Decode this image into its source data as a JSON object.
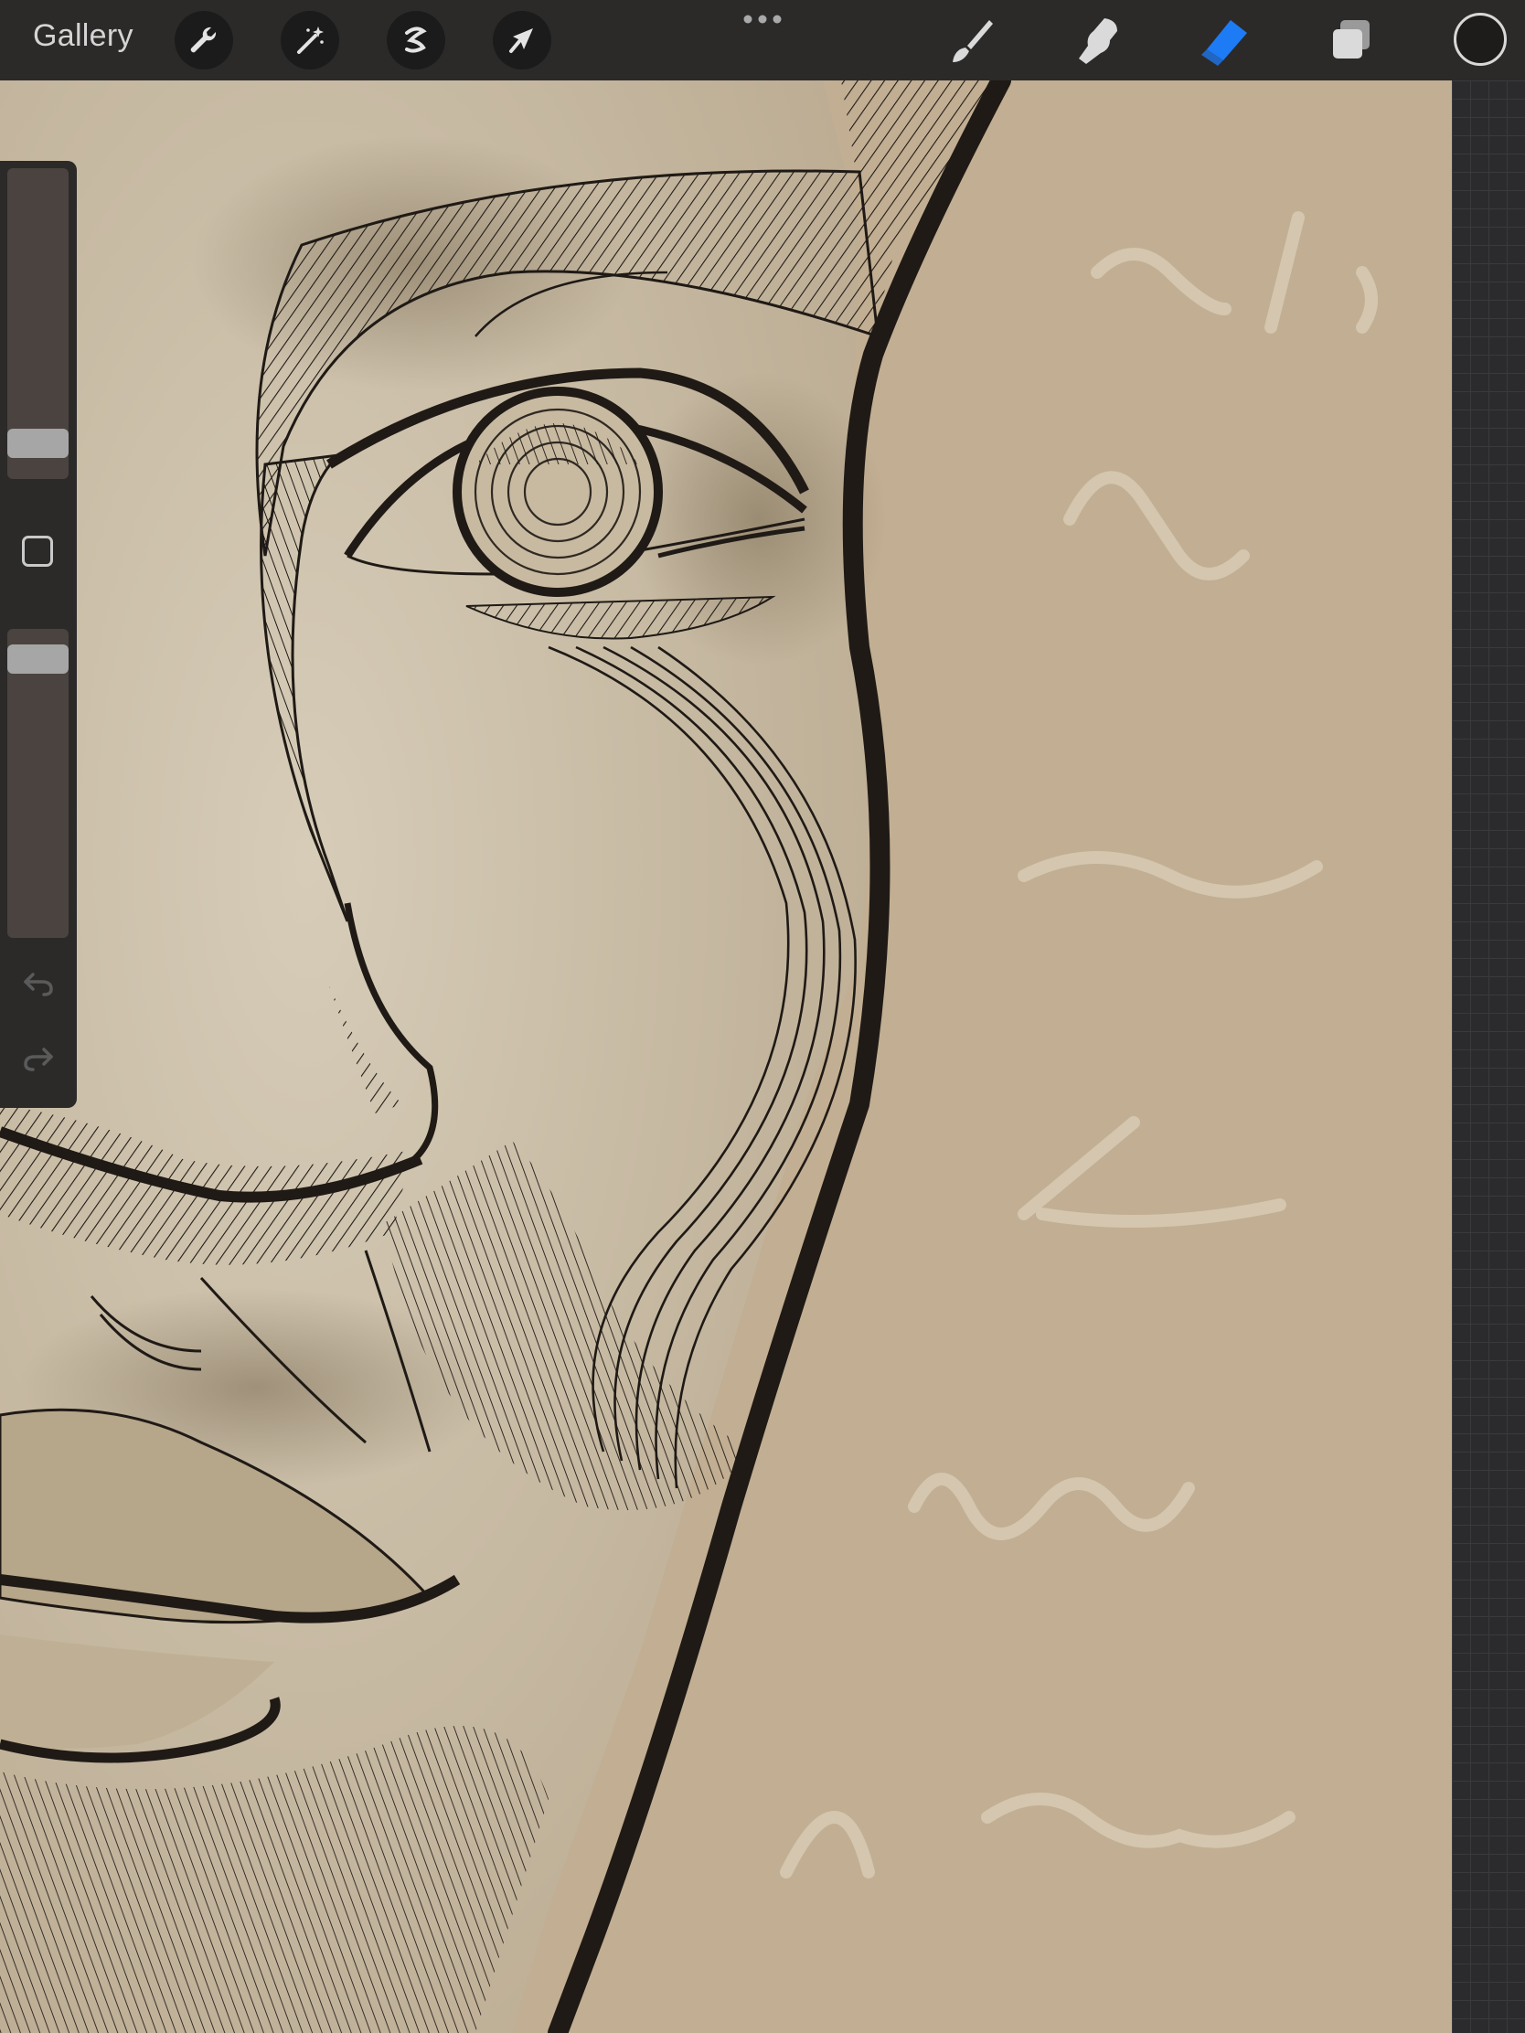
{
  "toolbar": {
    "gallery_label": "Gallery",
    "left_tools": [
      "wrench-icon",
      "magic-wand-icon",
      "selection-icon",
      "transform-arrow-icon"
    ],
    "right_tools": [
      "brush-icon",
      "smudge-icon",
      "eraser-icon",
      "layers-icon"
    ],
    "active_tool": "eraser-icon",
    "active_color": "#1d7bf5",
    "current_color": "#1e1c1a"
  },
  "sidebar": {
    "brush_size_level": 0.07,
    "opacity_level": 0.95
  },
  "colors": {
    "paper": "#c2ae92",
    "face_paper": "#d3c7b2",
    "ink": "#1f1a15",
    "script": "#e4dac7"
  }
}
